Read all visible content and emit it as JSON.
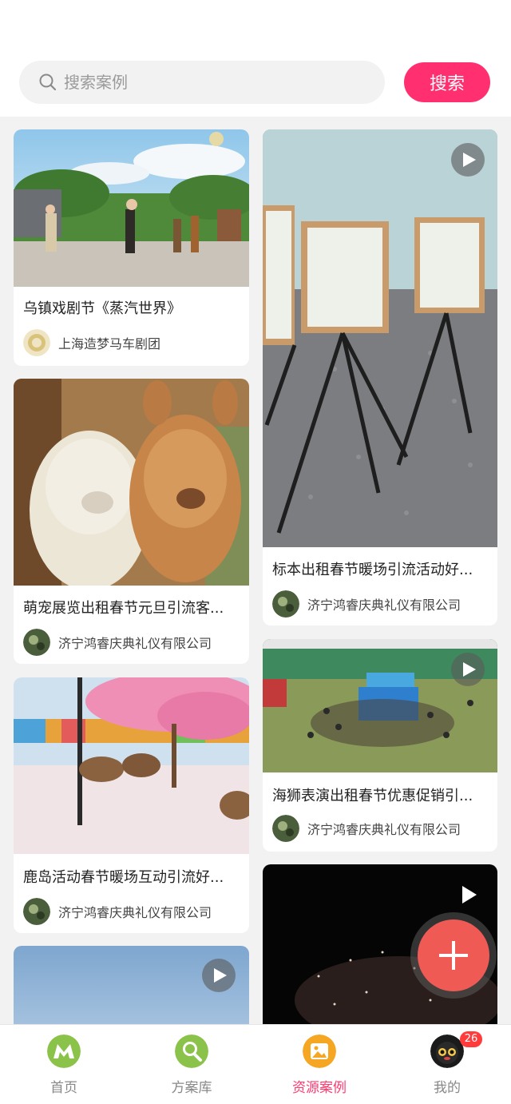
{
  "search": {
    "placeholder": "搜索案例",
    "button_label": "搜索"
  },
  "cards": [
    {
      "title": "乌镇戏剧节《蒸汽世界》",
      "author": "上海造梦马车剧团",
      "has_video": false
    },
    {
      "title": "萌宠展览出租春节元旦引流客...",
      "author": "济宁鸿睿庆典礼仪有限公司",
      "has_video": false
    },
    {
      "title": "鹿岛活动春节暖场互动引流好...",
      "author": "济宁鸿睿庆典礼仪有限公司",
      "has_video": false
    },
    {
      "title": "",
      "author": "",
      "has_video": true
    },
    {
      "title": "标本出租春节暖场引流活动好...",
      "author": "济宁鸿睿庆典礼仪有限公司",
      "has_video": true
    },
    {
      "title": "海狮表演出租春节优惠促销引...",
      "author": "济宁鸿睿庆典礼仪有限公司",
      "has_video": true
    },
    {
      "title": "",
      "author": "",
      "has_video": true
    }
  ],
  "tabs": [
    {
      "label": "首页",
      "icon": "home-logo-icon",
      "active": false
    },
    {
      "label": "方案库",
      "icon": "magnifier-icon",
      "active": false
    },
    {
      "label": "资源案例",
      "icon": "image-icon",
      "active": true
    },
    {
      "label": "我的",
      "icon": "cat-avatar-icon",
      "active": false,
      "badge": "26"
    }
  ],
  "fab": {
    "icon": "plus-icon"
  },
  "colors": {
    "accent": "#ff2f70",
    "active_tab": "#ff3b70",
    "fab": "#ef5a55"
  }
}
